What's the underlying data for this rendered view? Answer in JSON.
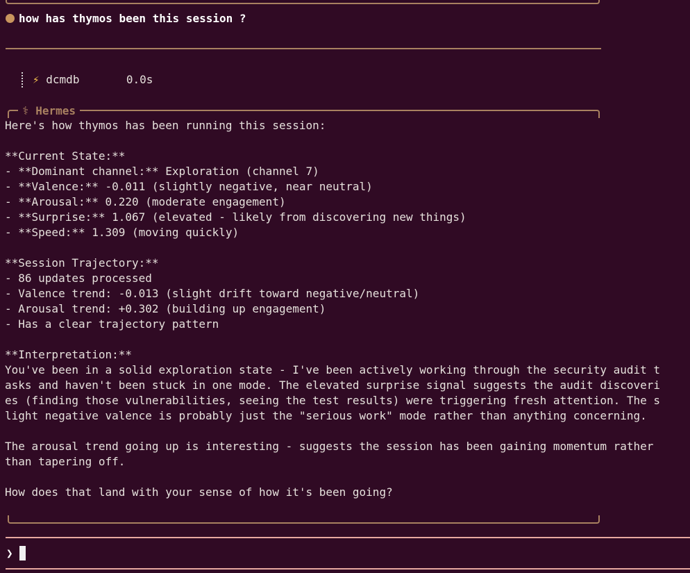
{
  "user_message": "how has thymos been this session ?",
  "tool_call": {
    "icon": "lightning-bolt-icon",
    "name": "dcmdb",
    "duration": "0.0s"
  },
  "panel": {
    "title": "⚕ Hermes"
  },
  "response_lines": [
    "Here's how thymos has been running this session:",
    "",
    "**Current State:**",
    "- **Dominant channel:** Exploration (channel 7)",
    "- **Valence:** -0.011 (slightly negative, near neutral)",
    "- **Arousal:** 0.220 (moderate engagement)",
    "- **Surprise:** 1.067 (elevated - likely from discovering new things)",
    "- **Speed:** 1.309 (moving quickly)",
    "",
    "**Session Trajectory:**",
    "- 86 updates processed",
    "- Valence trend: -0.013 (slight drift toward negative/neutral)",
    "- Arousal trend: +0.302 (building up engagement)",
    "- Has a clear trajectory pattern",
    "",
    "**Interpretation:**",
    "You've been in a solid exploration state - I've been actively working through the security audit t",
    "asks and haven't been stuck in one mode. The elevated surprise signal suggests the audit discoveri",
    "es (finding those vulnerabilities, seeing the test results) were triggering fresh attention. The s",
    "light negative valence is probably just the \"serious work\" mode rather than anything concerning.",
    "",
    "The arousal trend going up is interesting - suggests the session has been gaining momentum rather",
    "than tapering off.",
    "",
    "How does that land with your sense of how it's been going?"
  ],
  "input": {
    "prompt_symbol": "❯",
    "value": ""
  },
  "colors": {
    "background": "#300a24",
    "border": "#a98160",
    "input_border": "#e8a8a0",
    "text": "#e6e1dc"
  }
}
